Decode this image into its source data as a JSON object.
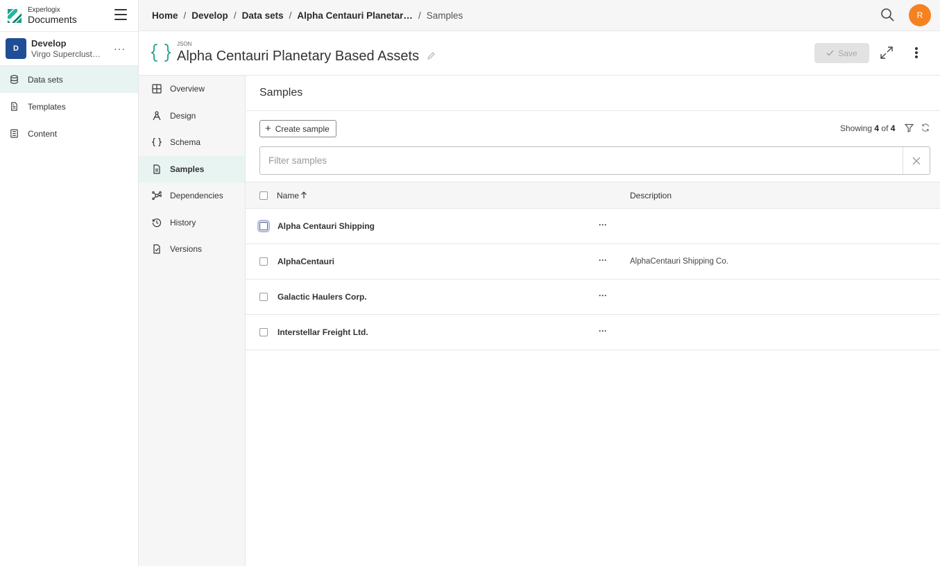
{
  "brand": {
    "top": "Experlogix",
    "bottom": "Documents"
  },
  "workspace": {
    "initial": "D",
    "name": "Develop",
    "subtitle": "Virgo Superclust…",
    "more": "···"
  },
  "sidebar": {
    "items": [
      {
        "label": "Data sets",
        "icon": "database-icon",
        "active": true
      },
      {
        "label": "Templates",
        "icon": "document-icon",
        "active": false
      },
      {
        "label": "Content",
        "icon": "content-icon",
        "active": false
      }
    ]
  },
  "breadcrumb": {
    "items": [
      "Home",
      "Develop",
      "Data sets",
      "Alpha Centauri Planetar…"
    ],
    "current": "Samples",
    "separator": "/"
  },
  "user": {
    "initial": "R",
    "color": "#f58220"
  },
  "header": {
    "badge": "JSON",
    "title": "Alpha Centauri Planetary Based Assets",
    "save_label": "Save"
  },
  "subnav": {
    "items": [
      {
        "label": "Overview",
        "icon": "grid-icon"
      },
      {
        "label": "Design",
        "icon": "design-icon"
      },
      {
        "label": "Schema",
        "icon": "braces-icon"
      },
      {
        "label": "Samples",
        "icon": "file-icon",
        "active": true
      },
      {
        "label": "Dependencies",
        "icon": "network-icon"
      },
      {
        "label": "History",
        "icon": "history-icon"
      },
      {
        "label": "Versions",
        "icon": "versions-icon"
      }
    ]
  },
  "main": {
    "section_title": "Samples",
    "create_label": "Create sample",
    "showing": {
      "prefix": "Showing",
      "shown": "4",
      "of": "of",
      "total": "4"
    },
    "filter_placeholder": "Filter samples",
    "columns": {
      "name": "Name",
      "description": "Description"
    },
    "rows": [
      {
        "name": "Alpha Centauri Shipping",
        "description": ""
      },
      {
        "name": "AlphaCentauri",
        "description": "AlphaCentauri Shipping Co."
      },
      {
        "name": "Galactic Haulers Corp.",
        "description": ""
      },
      {
        "name": "Interstellar Freight Ltd.",
        "description": ""
      }
    ],
    "row_more": "···"
  },
  "colors": {
    "accent": "#1a9e8a",
    "active_bg": "#e8f4f2",
    "workspace": "#1f4e96"
  }
}
